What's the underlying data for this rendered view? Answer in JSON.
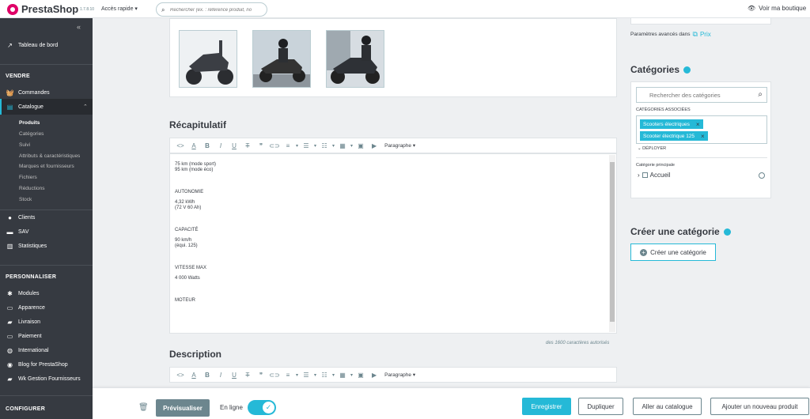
{
  "header": {
    "brand": "PrestaShop",
    "version": "1.7.8.10",
    "quick_access": "Accès rapide",
    "search_placeholder": "Rechercher (ex. : référence produit, no",
    "view_shop": "Voir ma boutique"
  },
  "sidebar": {
    "dashboard": "Tableau de bord",
    "section_sell": "VENDRE",
    "orders": "Commandes",
    "catalog": "Catalogue",
    "catalog_sub": [
      "Produits",
      "Catégories",
      "Suivi",
      "Attributs & caractéristiques",
      "Marques et fournisseurs",
      "Fichiers",
      "Réductions",
      "Stock"
    ],
    "customers": "Clients",
    "sav": "SAV",
    "stats": "Statistiques",
    "section_customize": "PERSONNALISER",
    "modules": "Modules",
    "appearance": "Apparence",
    "shipping": "Livraison",
    "payment": "Paiement",
    "international": "International",
    "blog": "Blog for PrestaShop",
    "wk": "Wk Gestion Fournisseurs",
    "section_configure": "CONFIGURER"
  },
  "main": {
    "summary_title": "Récapitulatif",
    "description_title": "Description",
    "paragraph_label": "Paragraphe",
    "summary_lines": [
      "75 km (mode sport)",
      "95 km (mode éco)",
      "AUTONOMIE",
      "4,32 kWh",
      "(72 V 60 Ah)",
      "CAPACITÉ",
      "90 km/h",
      "(équi. 125)",
      "VITESSE MAX",
      "4 000 Watts",
      "MOTEUR"
    ],
    "char_limit": "des 1600 caractères autorisés"
  },
  "right": {
    "advanced_params": "Paramètres avancés dans",
    "price_link": "Prix",
    "categories_title": "Catégories",
    "category_search_placeholder": "Rechercher des catégories",
    "associated_label": "CATÉGORIES ASSOCIÉES",
    "tags": [
      "Scooters électriques",
      "Scooter électrique 125"
    ],
    "expand": "DÉPLOYER",
    "main_category_label": "Catégorie principale",
    "tree_item": "Accueil",
    "create_title": "Créer une catégorie",
    "create_button": "Créer une catégorie"
  },
  "footer": {
    "preview": "Prévisualiser",
    "online": "En ligne",
    "save": "Enregistrer",
    "duplicate": "Dupliquer",
    "to_catalog": "Aller au catalogue",
    "add_new": "Ajouter un nouveau produit"
  },
  "colors": {
    "accent": "#25b9d7",
    "sidebar": "#363a41",
    "brand": "#df0067"
  }
}
